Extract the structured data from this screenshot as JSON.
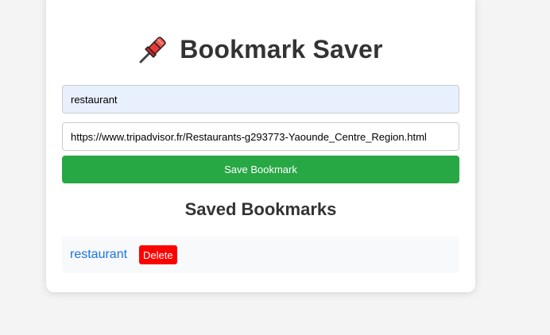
{
  "header": {
    "title": "Bookmark Saver",
    "icon": "pushpin-icon"
  },
  "form": {
    "title_value": "restaurant",
    "url_value": "https://www.tripadvisor.fr/Restaurants-g293773-Yaounde_Centre_Region.html",
    "save_label": "Save Bookmark"
  },
  "saved": {
    "heading": "Saved Bookmarks",
    "items": [
      {
        "label": "restaurant",
        "delete_label": "Delete"
      }
    ]
  },
  "colors": {
    "save_button": "#28a745",
    "delete_button": "#ff0000",
    "link": "#1a73e8",
    "title_input_bg": "#e8f0fe"
  }
}
